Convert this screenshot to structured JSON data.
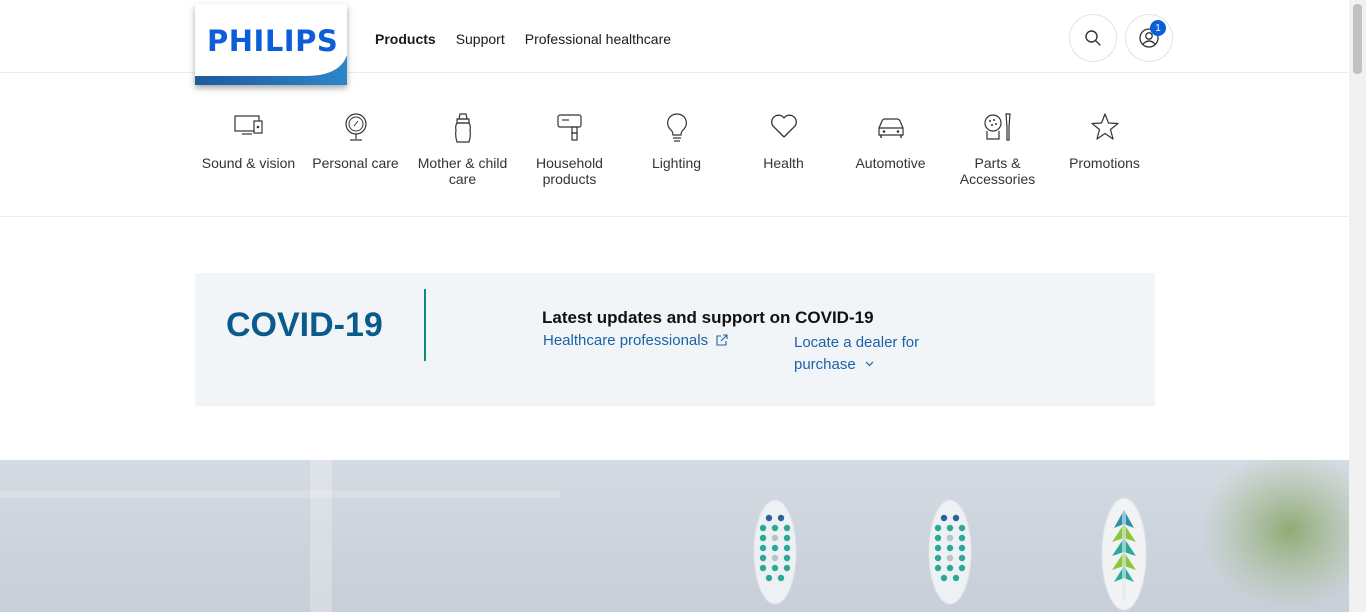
{
  "brand": {
    "logo_text": "PHILIPS",
    "logo_color": "#0b5ed7"
  },
  "topnav": {
    "items": [
      {
        "label": "Products",
        "active": true
      },
      {
        "label": "Support"
      },
      {
        "label": "Professional healthcare"
      }
    ]
  },
  "header_actions": {
    "search_icon": "search-icon",
    "account_icon": "user-icon",
    "account_badge": "1"
  },
  "categories": [
    {
      "label": "Sound & vision",
      "icon": "monitor-icon"
    },
    {
      "label": "Personal care",
      "icon": "mirror-icon"
    },
    {
      "label": "Mother & child care",
      "icon": "baby-bottle-icon"
    },
    {
      "label": "Household products",
      "icon": "mixer-icon"
    },
    {
      "label": "Lighting",
      "icon": "lightbulb-icon"
    },
    {
      "label": "Health",
      "icon": "heart-icon"
    },
    {
      "label": "Automotive",
      "icon": "car-icon"
    },
    {
      "label": "Parts & Accessories",
      "icon": "parts-icon"
    },
    {
      "label": "Promotions",
      "icon": "star-icon"
    }
  ],
  "covid_banner": {
    "title": "COVID-19",
    "heading": "Latest updates and support on COVID-19",
    "link_healthcare": "Healthcare professionals",
    "link_dealer": "Locate a dealer for purchase"
  },
  "colors": {
    "accent_blue": "#0b5ed7",
    "covid_title": "#0b5a8c",
    "covid_rule": "#0e8a7e",
    "link": "#1b62a8",
    "banner_bg": "#f1f5f8"
  }
}
